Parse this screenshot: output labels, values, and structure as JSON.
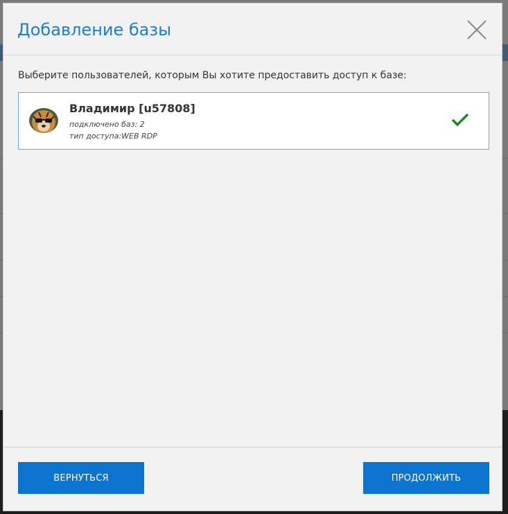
{
  "modal": {
    "title": "Добавление базы",
    "prompt": "Выберите пользователей, которым Вы хотите предоставить доступ к базе:"
  },
  "users": [
    {
      "name": "Владимир [u57808]",
      "databases": "подключено баз: 2",
      "access_type": "тип доступа:WEB RDP",
      "selected": true,
      "avatar": "tiger-with-sunglasses"
    }
  ],
  "buttons": {
    "back": "ВЕРНУТЬСЯ",
    "continue": "ПРОДОЛЖИТЬ"
  },
  "colors": {
    "accent": "#1b7dd3",
    "button": "#0a74cf",
    "check": "#1a8a1a"
  }
}
